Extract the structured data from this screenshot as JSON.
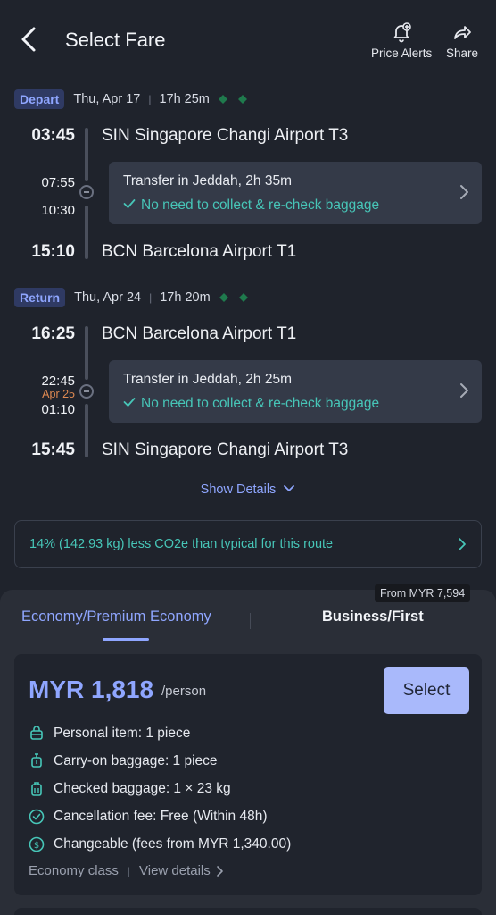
{
  "header": {
    "title": "Select Fare",
    "price_alerts_label": "Price Alerts",
    "share_label": "Share"
  },
  "depart": {
    "badge": "Depart",
    "date": "Thu, Apr 17",
    "duration": "17h 25m",
    "dep_time": "03:45",
    "dep_airport": "SIN Singapore Changi Airport T3",
    "transfer_arrive": "07:55",
    "transfer_depart": "10:30",
    "transfer_text": "Transfer in Jeddah, 2h 35m",
    "baggage_text": "No need to collect & re-check baggage",
    "arr_time": "15:10",
    "arr_airport": "BCN Barcelona Airport T1"
  },
  "return": {
    "badge": "Return",
    "date": "Thu, Apr 24",
    "duration": "17h 20m",
    "dep_time": "16:25",
    "dep_airport": "BCN Barcelona Airport T1",
    "transfer_arrive": "22:45",
    "transfer_date": "Apr 25",
    "transfer_depart": "01:10",
    "transfer_text": "Transfer in Jeddah, 2h 25m",
    "baggage_text": "No need to collect & re-check baggage",
    "arr_time": "15:45",
    "arr_airport": "SIN Singapore Changi Airport T3"
  },
  "show_details": "Show Details",
  "eco_banner": "14% (142.93 kg) less CO2e than typical for this route",
  "tabs": {
    "from_badge": "From MYR 7,594",
    "economy": "Economy/Premium Economy",
    "business": "Business/First"
  },
  "fare": {
    "price": "MYR 1,818",
    "per": "/person",
    "select_label": "Select",
    "features": [
      "Personal item: 1 piece",
      "Carry-on baggage: 1 piece",
      "Checked baggage: 1 × 23 kg",
      "Cancellation fee: Free (Within 48h)",
      "Changeable (fees from MYR 1,340.00)"
    ],
    "class_label": "Economy class",
    "view_details": "View details"
  },
  "colors": {
    "accent": "#8fa6ff",
    "teal": "#47c6b8",
    "background": "#1f232c",
    "select_button": "#a9b9fb"
  }
}
